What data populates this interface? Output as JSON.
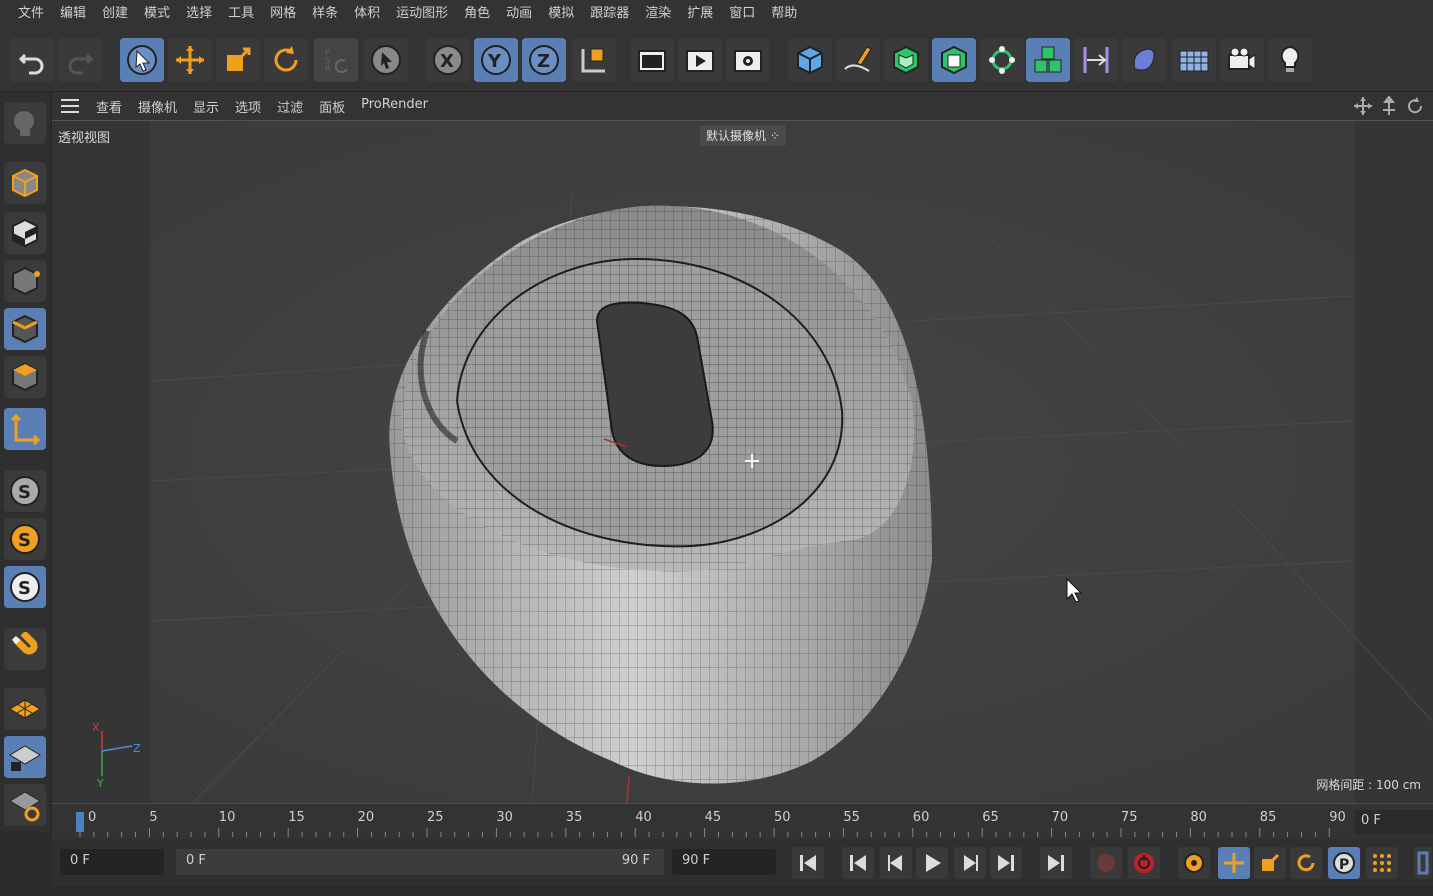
{
  "menu": [
    "文件",
    "编辑",
    "创建",
    "模式",
    "选择",
    "工具",
    "网格",
    "样条",
    "体积",
    "运动图形",
    "角色",
    "动画",
    "模拟",
    "跟踪器",
    "渲染",
    "扩展",
    "窗口",
    "帮助"
  ],
  "viewport_menu": [
    "查看",
    "摄像机",
    "显示",
    "选项",
    "过滤",
    "面板",
    "ProRender"
  ],
  "viewport": {
    "name": "透视视图",
    "camera": "默认摄像机",
    "grid_distance": "网格间距 : 100 cm",
    "axis_labels": {
      "x": "X",
      "y": "Y",
      "z": "Z"
    }
  },
  "timeline": {
    "ticks": [
      "0",
      "5",
      "10",
      "15",
      "20",
      "25",
      "30",
      "35",
      "40",
      "45",
      "50",
      "55",
      "60",
      "65",
      "70",
      "75",
      "80",
      "85",
      "90"
    ],
    "current_frame": "0 F"
  },
  "transport": {
    "start_field": "0 F",
    "range_start": "0 F",
    "range_end": "90 F",
    "end_field": "90 F"
  },
  "toolbar_icons": [
    "undo-icon",
    "redo-icon",
    "select-icon",
    "move-icon",
    "scale-icon",
    "rotate-icon",
    "psr-icon",
    "live-select-icon",
    "x-axis-icon",
    "y-axis-icon",
    "z-axis-icon",
    "coord-system-icon",
    "render-region-icon",
    "render-view-icon",
    "render-settings-icon",
    "cube-icon",
    "pen-icon",
    "subdivision-icon",
    "extrude-icon",
    "cloner-icon",
    "mograph-icon",
    "deformer-icon",
    "field-icon",
    "floor-icon",
    "camera-icon",
    "light-icon"
  ],
  "colors": {
    "selected": "#5a7fb5",
    "accent_orange": "#f0a020",
    "model_light": "#bcbcbc"
  }
}
